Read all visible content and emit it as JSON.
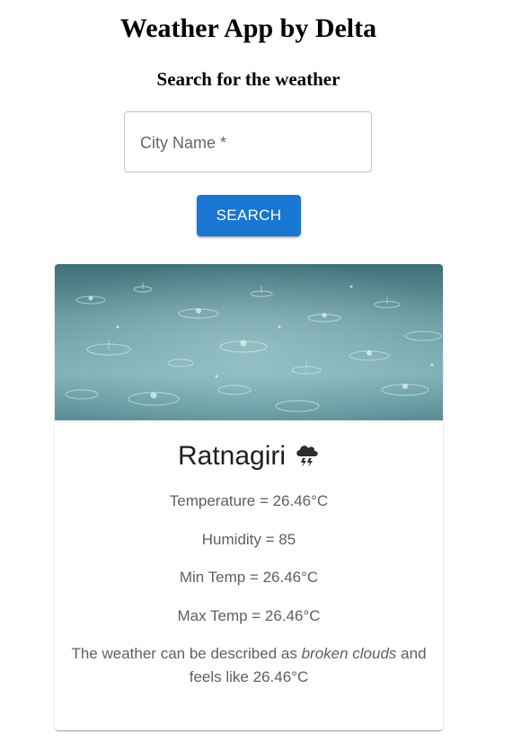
{
  "header": {
    "title": "Weather App by Delta",
    "subtitle": "Search for the weather"
  },
  "search": {
    "label": "City Name *",
    "value": "",
    "button_label": "SEARCH"
  },
  "weather": {
    "city": "Ratnagiri",
    "icon": "thunderstorm-cloud-icon",
    "temperature_line": "Temperature = 26.46°C",
    "humidity_line": "Humidity = 85",
    "min_temp_line": "Min Temp = 26.46°C",
    "max_temp_line": "Max Temp = 26.46°C",
    "description_prefix": "The weather can be described as",
    "description_value": "broken clouds",
    "description_suffix": "and feels like 26.46°C"
  },
  "colors": {
    "primary": "#1976d2",
    "text_secondary": "#5f5f5f",
    "rain_water": "#5e8f97"
  }
}
